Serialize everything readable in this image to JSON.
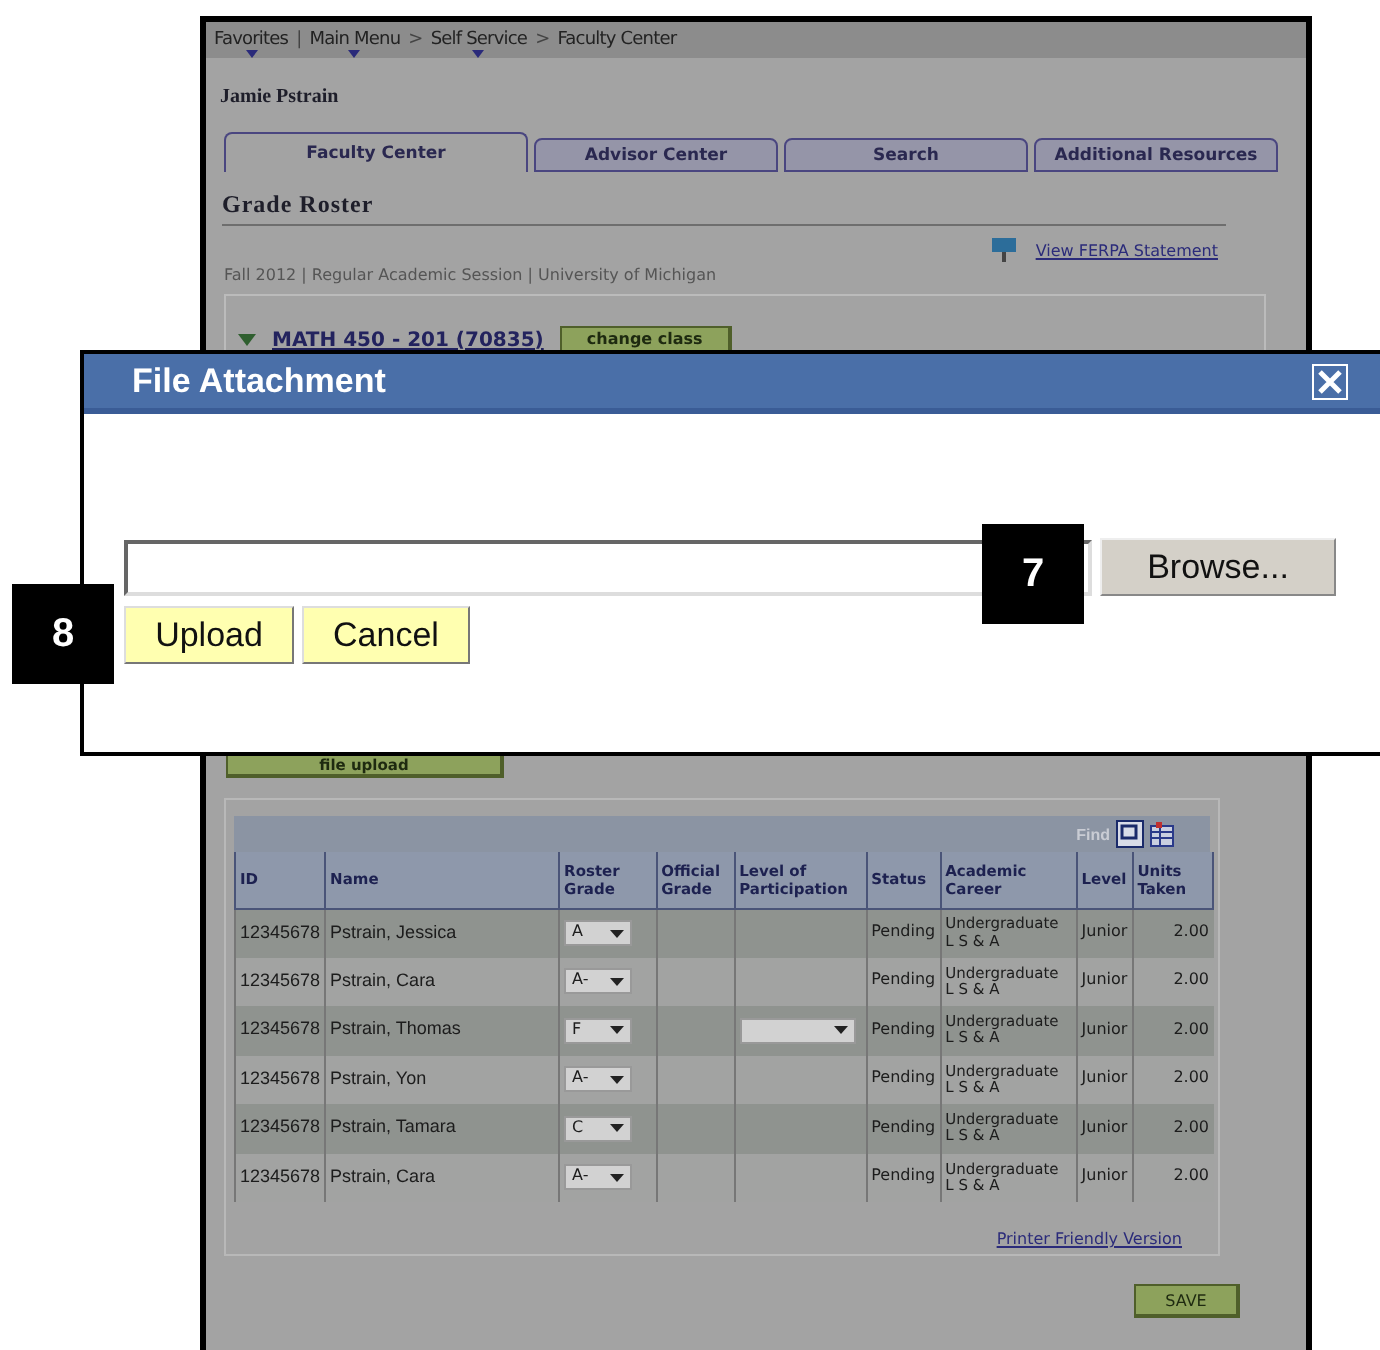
{
  "breadcrumb": [
    {
      "label": "Favorites",
      "menu": true,
      "separator": "|"
    },
    {
      "label": "Main Menu",
      "menu": true,
      "separator": ">"
    },
    {
      "label": "Self Service",
      "menu": true,
      "separator": ">"
    },
    {
      "label": "Faculty Center",
      "menu": false
    }
  ],
  "user_name": "Jamie Pstrain",
  "tabs": [
    {
      "label": "Faculty Center",
      "selected": true
    },
    {
      "label": "Advisor Center",
      "selected": false
    },
    {
      "label": "Search",
      "selected": false
    },
    {
      "label": "Additional Resources",
      "selected": false
    }
  ],
  "page_title": "Grade Roster",
  "ferpa_link": "View FERPA Statement",
  "term_info": "Fall 2012 | Regular Academic Session | University of Michigan",
  "course": {
    "expanded": true,
    "title": "MATH 450 - 201 (70835)",
    "button": "change class"
  },
  "dialog": {
    "title": "File Attachment",
    "browse_button": "Browse...",
    "buttons": [
      "Upload",
      "Cancel"
    ]
  },
  "callouts": [
    "7",
    "8"
  ],
  "file_upload_button": "file upload",
  "grid": {
    "find": "Find",
    "columns": [
      "ID",
      "Name",
      "Roster Grade",
      "Official Grade",
      "Level of Participation",
      "Status",
      "Academic Career",
      "Level",
      "Units Taken"
    ],
    "rows": [
      {
        "id": "12345678",
        "name": "Pstrain, Jessica",
        "grade": "A",
        "participation_dropdown": false,
        "status": "Pending",
        "career": "Undergraduate",
        "program": "L S & A",
        "level": "Junior",
        "units": "2.00"
      },
      {
        "id": "12345678",
        "name": "Pstrain, Cara",
        "grade": "A-",
        "participation_dropdown": false,
        "status": "Pending",
        "career": "Undergraduate",
        "program": "L S & A",
        "level": "Junior",
        "units": "2.00"
      },
      {
        "id": "12345678",
        "name": "Pstrain, Thomas",
        "grade": "F",
        "participation_dropdown": true,
        "status": "Pending",
        "career": "Undergraduate",
        "program": "L S & A",
        "level": "Junior",
        "units": "2.00"
      },
      {
        "id": "12345678",
        "name": "Pstrain, Yon",
        "grade": "A-",
        "participation_dropdown": false,
        "status": "Pending",
        "career": "Undergraduate",
        "program": "L S & A",
        "level": "Junior",
        "units": "2.00"
      },
      {
        "id": "12345678",
        "name": "Pstrain, Tamara",
        "grade": "C",
        "participation_dropdown": false,
        "status": "Pending",
        "career": "Undergraduate",
        "program": "L S & A",
        "level": "Junior",
        "units": "2.00"
      },
      {
        "id": "12345678",
        "name": "Pstrain, Cara",
        "grade": "A-",
        "participation_dropdown": false,
        "status": "Pending",
        "career": "Undergraduate",
        "program": "L S & A",
        "level": "Junior",
        "units": "2.00"
      }
    ]
  },
  "printer_link": "Printer Friendly Version",
  "save_button": "SAVE"
}
